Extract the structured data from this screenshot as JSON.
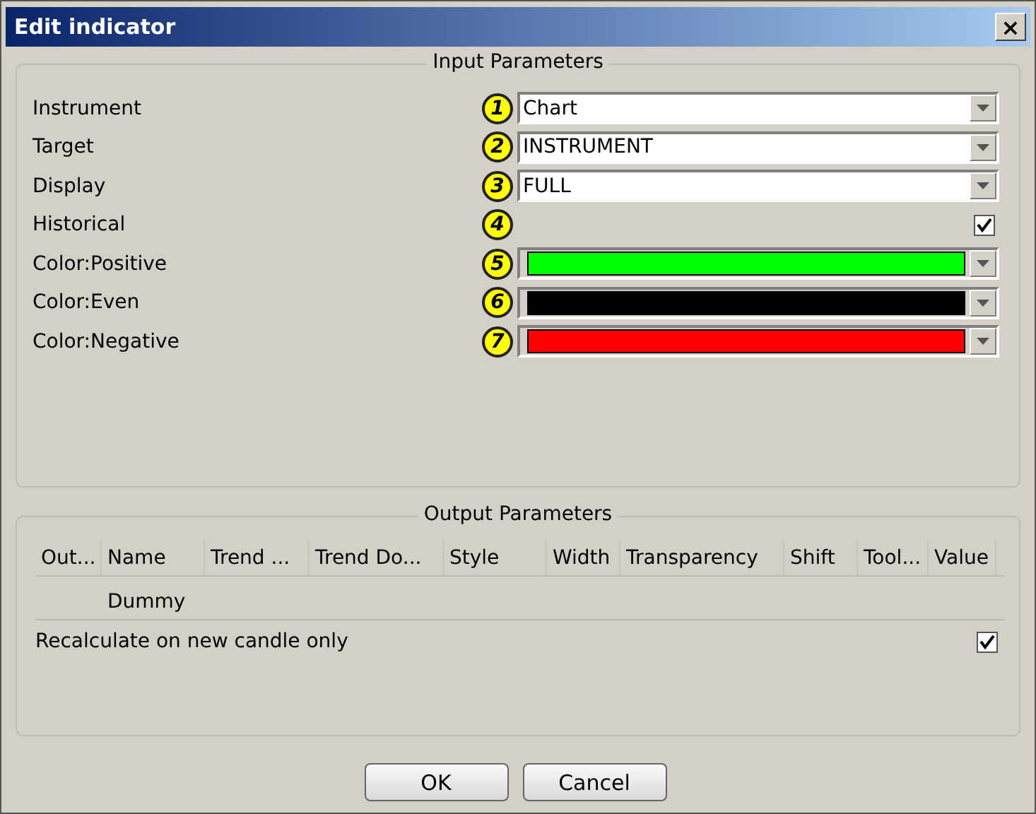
{
  "window": {
    "title": "Edit indicator",
    "close": "×"
  },
  "input_parameters": {
    "title": "Input Parameters",
    "rows": [
      {
        "label": "Instrument",
        "badge": "1",
        "kind": "dropdown",
        "value": "Chart"
      },
      {
        "label": "Target",
        "badge": "2",
        "kind": "dropdown",
        "value": "INSTRUMENT"
      },
      {
        "label": "Display",
        "badge": "3",
        "kind": "dropdown",
        "value": "FULL"
      },
      {
        "label": "Historical",
        "badge": "4",
        "kind": "checkbox",
        "checked": true
      },
      {
        "label": "Color:Positive",
        "badge": "5",
        "kind": "color",
        "color": "#00ff00"
      },
      {
        "label": "Color:Even",
        "badge": "6",
        "kind": "color",
        "color": "#000000"
      },
      {
        "label": "Color:Negative",
        "badge": "7",
        "kind": "color",
        "color": "#ff0000"
      }
    ]
  },
  "output_parameters": {
    "title": "Output Parameters",
    "table": {
      "columns": [
        "Out...",
        "Name",
        "Trend ...",
        "Trend Do...",
        "Style",
        "Width",
        "Transparency",
        "Shift",
        "Tool...",
        "Value"
      ],
      "rows": [
        [
          "",
          "Dummy",
          "",
          "",
          "",
          "",
          "",
          "",
          "",
          ""
        ]
      ]
    },
    "recalculate": {
      "label": "Recalculate on new candle only",
      "checked": true
    }
  },
  "buttons": [
    "OK",
    "Cancel"
  ]
}
